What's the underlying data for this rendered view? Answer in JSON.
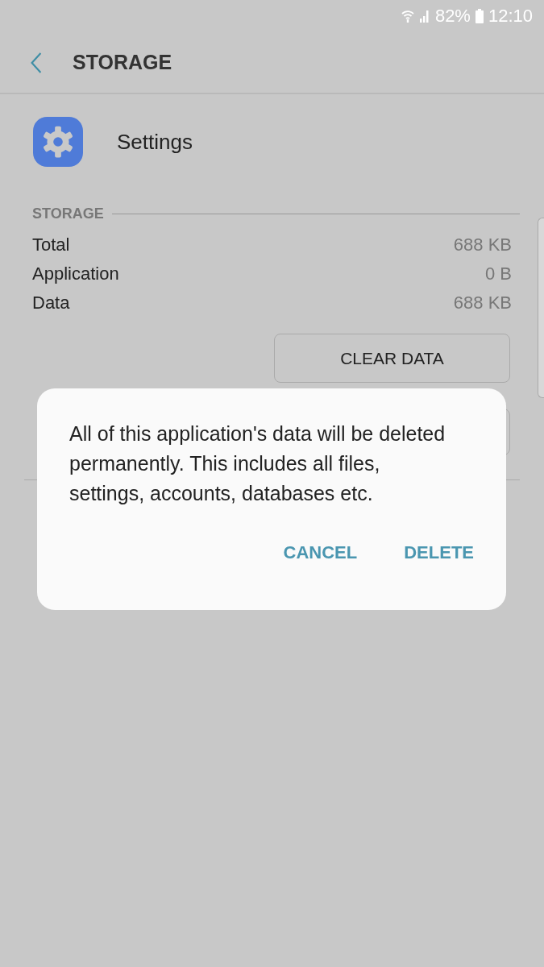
{
  "status_bar": {
    "battery": "82%",
    "time": "12:10"
  },
  "toolbar": {
    "title": "STORAGE"
  },
  "app": {
    "name": "Settings"
  },
  "storage": {
    "heading": "STORAGE",
    "rows": [
      {
        "label": "Total",
        "value": "688 KB"
      },
      {
        "label": "Application",
        "value": "0 B"
      },
      {
        "label": "Data",
        "value": "688 KB"
      }
    ],
    "button": "CLEAR DATA"
  },
  "dialog": {
    "message": "All of this application's data will be deleted permanently. This includes all files, settings, accounts, databases etc.",
    "buttons": [
      "CANCEL",
      "DELETE"
    ]
  }
}
